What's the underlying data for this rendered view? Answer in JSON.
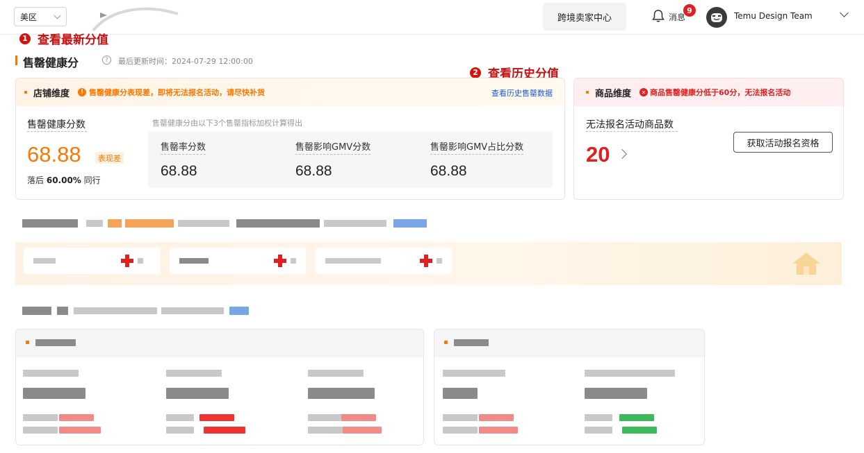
{
  "header": {
    "region": "美区",
    "seller_center": "跨境卖家中心",
    "messages_label": "消息",
    "messages_count": "9",
    "account_name": "Temu Design Team"
  },
  "annotations": {
    "latest": {
      "num": "1",
      "text": "查看最新分值"
    },
    "history": {
      "num": "2",
      "text": "查看历史分值"
    }
  },
  "section": {
    "title": "售罄健康分",
    "help_icon": "question-circle-icon",
    "updated": "最后更新时间：2024-07-29 12:00:00"
  },
  "store_card": {
    "dimension": "店铺维度",
    "warning": "售罄健康分表现差，即将无法报名活动，请尽快补货",
    "history_link": "查看历史售罄数据",
    "score_label": "售罄健康分数",
    "score": "68.88",
    "performance": "表现差",
    "behind_prefix": "落后",
    "behind_percent": "60.00%",
    "behind_suffix": "同行",
    "calc_note": "售罄健康分由以下3个售罄指标加权计算得出",
    "metrics": [
      {
        "label": "售罄率分数",
        "value": "68.88"
      },
      {
        "label": "售罄影响GMV分数",
        "value": "68.88"
      },
      {
        "label": "售罄影响GMV占比分数",
        "value": "68.88"
      }
    ]
  },
  "product_card": {
    "dimension": "商品维度",
    "warning": "商品售罄健康分低于60分，无法报名活动",
    "count_label": "无法报名活动商品数",
    "count": "20",
    "qualify_button": "获取活动报名资格"
  },
  "colors": {
    "accent": "#fb7701",
    "danger": "#e02020",
    "link": "#1a5ad8"
  }
}
